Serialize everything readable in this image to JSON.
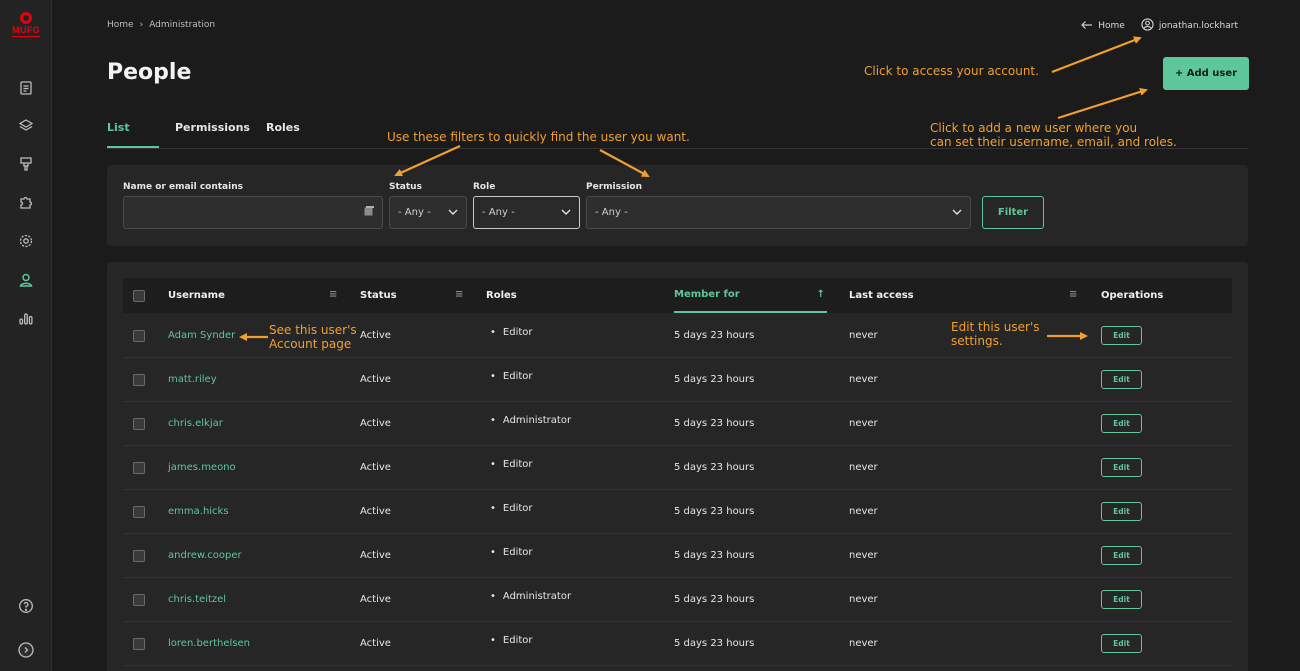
{
  "brand": {
    "name": "MUFG",
    "color": "#e60012"
  },
  "accent": "#5ec79a",
  "annotation_color": "#f0a030",
  "sidebar": {
    "icons": [
      "document-icon",
      "layers-icon",
      "brush-icon",
      "puzzle-icon",
      "gear-icon",
      "user-icon",
      "chart-icon"
    ],
    "bottom": [
      "help-icon",
      "expand-icon"
    ]
  },
  "breadcrumb": {
    "home": "Home",
    "separator": "›",
    "current": "Administration"
  },
  "topbar": {
    "home_label": "Home",
    "user_label": "jonathan.lockhart"
  },
  "page": {
    "title": "People",
    "add_user_label": "+ Add user"
  },
  "tabs": [
    {
      "label": "List"
    },
    {
      "label": "Permissions"
    },
    {
      "label": "Roles"
    }
  ],
  "filters": {
    "name_label": "Name or email contains",
    "name_value": "",
    "status_label": "Status",
    "status_value": "- Any -",
    "role_label": "Role",
    "role_value": "- Any -",
    "permission_label": "Permission",
    "permission_value": "- Any -",
    "filter_label": "Filter"
  },
  "table": {
    "columns": {
      "username": "Username",
      "status": "Status",
      "roles": "Roles",
      "member_for": "Member for",
      "last_access": "Last access",
      "operations": "Operations"
    },
    "edit_label": "Edit",
    "rows": [
      {
        "username": "Adam Synder",
        "status": "Active",
        "role": "Editor",
        "member_for": "5 days 23 hours",
        "last_access": "never"
      },
      {
        "username": "matt.riley",
        "status": "Active",
        "role": "Editor",
        "member_for": "5 days 23 hours",
        "last_access": "never"
      },
      {
        "username": "chris.elkjar",
        "status": "Active",
        "role": "Administrator",
        "member_for": "5 days 23 hours",
        "last_access": "never"
      },
      {
        "username": "james.meono",
        "status": "Active",
        "role": "Editor",
        "member_for": "5 days 23 hours",
        "last_access": "never"
      },
      {
        "username": "emma.hicks",
        "status": "Active",
        "role": "Editor",
        "member_for": "5 days 23 hours",
        "last_access": "never"
      },
      {
        "username": "andrew.cooper",
        "status": "Active",
        "role": "Editor",
        "member_for": "5 days 23 hours",
        "last_access": "never"
      },
      {
        "username": "chris.teitzel",
        "status": "Active",
        "role": "Administrator",
        "member_for": "5 days 23 hours",
        "last_access": "never"
      },
      {
        "username": "loren.berthelsen",
        "status": "Active",
        "role": "Editor",
        "member_for": "5 days 23 hours",
        "last_access": "never"
      }
    ]
  },
  "annotations": {
    "account": "Click to access your account.",
    "add_user_line1": "Click to add a new user where you",
    "add_user_line2": "can set their username, email, and roles.",
    "filters": "Use these filters to quickly find the user you want.",
    "user_page_line1": "See this user's",
    "user_page_line2": "Account page",
    "edit_line1": "Edit this user's",
    "edit_line2": "settings."
  }
}
